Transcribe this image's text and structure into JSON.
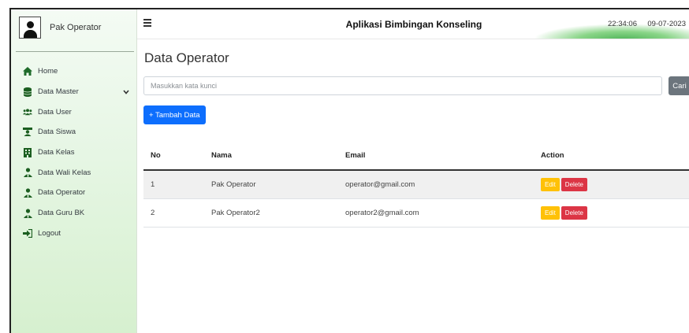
{
  "profile": {
    "name": "Pak Operator",
    "avatar_icon": "user-avatar-icon"
  },
  "sidebar": {
    "items": [
      {
        "label": "Home",
        "icon": "home-icon",
        "icon_color": "#2e7d32"
      },
      {
        "label": "Data Master",
        "icon": "database-icon",
        "icon_color": "#1b5e20",
        "has_dropdown": true
      },
      {
        "label": "Data User",
        "icon": "users-icon",
        "icon_color": "#1b5e20"
      },
      {
        "label": "Data Siswa",
        "icon": "student-icon",
        "icon_color": "#1b5e20"
      },
      {
        "label": "Data Kelas",
        "icon": "building-icon",
        "icon_color": "#1b5e20"
      },
      {
        "label": "Data Wali Kelas",
        "icon": "user-tie-icon",
        "icon_color": "#1b5e20"
      },
      {
        "label": "Data Operator",
        "icon": "user-tie-icon",
        "icon_color": "#1b5e20"
      },
      {
        "label": "Data Guru BK",
        "icon": "user-tie-icon",
        "icon_color": "#1b5e20"
      },
      {
        "label": "Logout",
        "icon": "sign-out-icon",
        "icon_color": "#1b5e20"
      }
    ]
  },
  "header": {
    "menu_icon": "hamburger-icon",
    "title": "Aplikasi Bimbingan Konseling",
    "time": "22:34:06",
    "date": "09-07-2023"
  },
  "main": {
    "page_title": "Data Operator",
    "search": {
      "placeholder": "Masukkan kata kunci",
      "value": "",
      "button_label": "Cari"
    },
    "add_button_label": "+ Tambah Data",
    "table": {
      "columns": [
        "No",
        "Nama",
        "Email",
        "Action"
      ],
      "rows": [
        {
          "no": "1",
          "nama": "Pak Operator",
          "email": "operator@gmail.com",
          "edit": "Edit",
          "delete": "Delete"
        },
        {
          "no": "2",
          "nama": "Pak Operator2",
          "email": "operator2@gmail.com",
          "edit": "Edit",
          "delete": "Delete"
        }
      ]
    }
  },
  "colors": {
    "primary": "#0d6efd",
    "secondary": "#6c757d",
    "warning": "#ffc107",
    "danger": "#dc3545",
    "sidebar_tint": "#e6f6e4"
  }
}
